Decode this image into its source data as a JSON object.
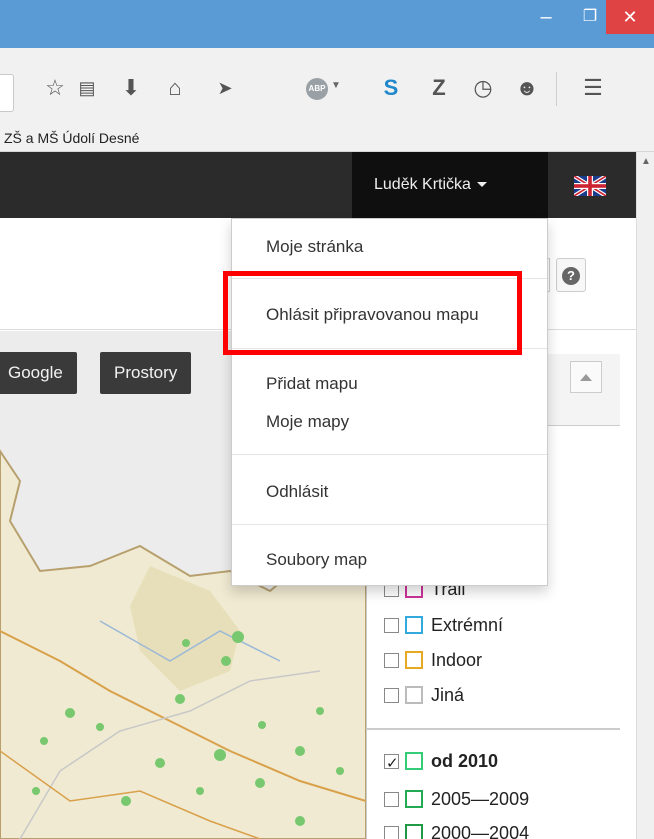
{
  "window": {
    "minimize": "–",
    "maximize": "❐",
    "close": "✕"
  },
  "toolbar": {
    "icons": [
      "star-icon",
      "reader-icon",
      "download-icon",
      "home-icon",
      "send-icon",
      "adblock-icon",
      "s-icon",
      "z-icon",
      "history-icon",
      "chat-icon",
      "menu-icon"
    ],
    "abp_label": "ABP"
  },
  "bookmarks": {
    "item": "ZŠ a MŠ Údolí Desné"
  },
  "header": {
    "user_name": "Luděk Krtička",
    "flag": "uk-flag"
  },
  "map_buttons": {
    "google": "Google",
    "prostory": "Prostory"
  },
  "dropdown": {
    "items": [
      "Moje stránka",
      "Ohlásit připravovanou mapu",
      "Přidat mapu",
      "Moje mapy",
      "Odhlásit",
      "Soubory map"
    ]
  },
  "filters": {
    "types": [
      {
        "label": "Trail",
        "color": "#cc3399",
        "checked": false
      },
      {
        "label": "Extrémní",
        "color": "#33aadd",
        "checked": false
      },
      {
        "label": "Indoor",
        "color": "#e8a820",
        "checked": false
      },
      {
        "label": "Jiná",
        "color": "#bbbbbb",
        "checked": false
      }
    ],
    "years": [
      {
        "label": "od 2010",
        "color": "#33cc77",
        "checked": true
      },
      {
        "label": "2005—2009",
        "color": "#22aa55",
        "checked": false
      },
      {
        "label": "2000—2004",
        "color": "#229944",
        "checked": false
      }
    ]
  },
  "colors": {
    "highlight": "#ff0000",
    "header": "#2b2b2b",
    "titlebar": "#5b9bd5"
  }
}
